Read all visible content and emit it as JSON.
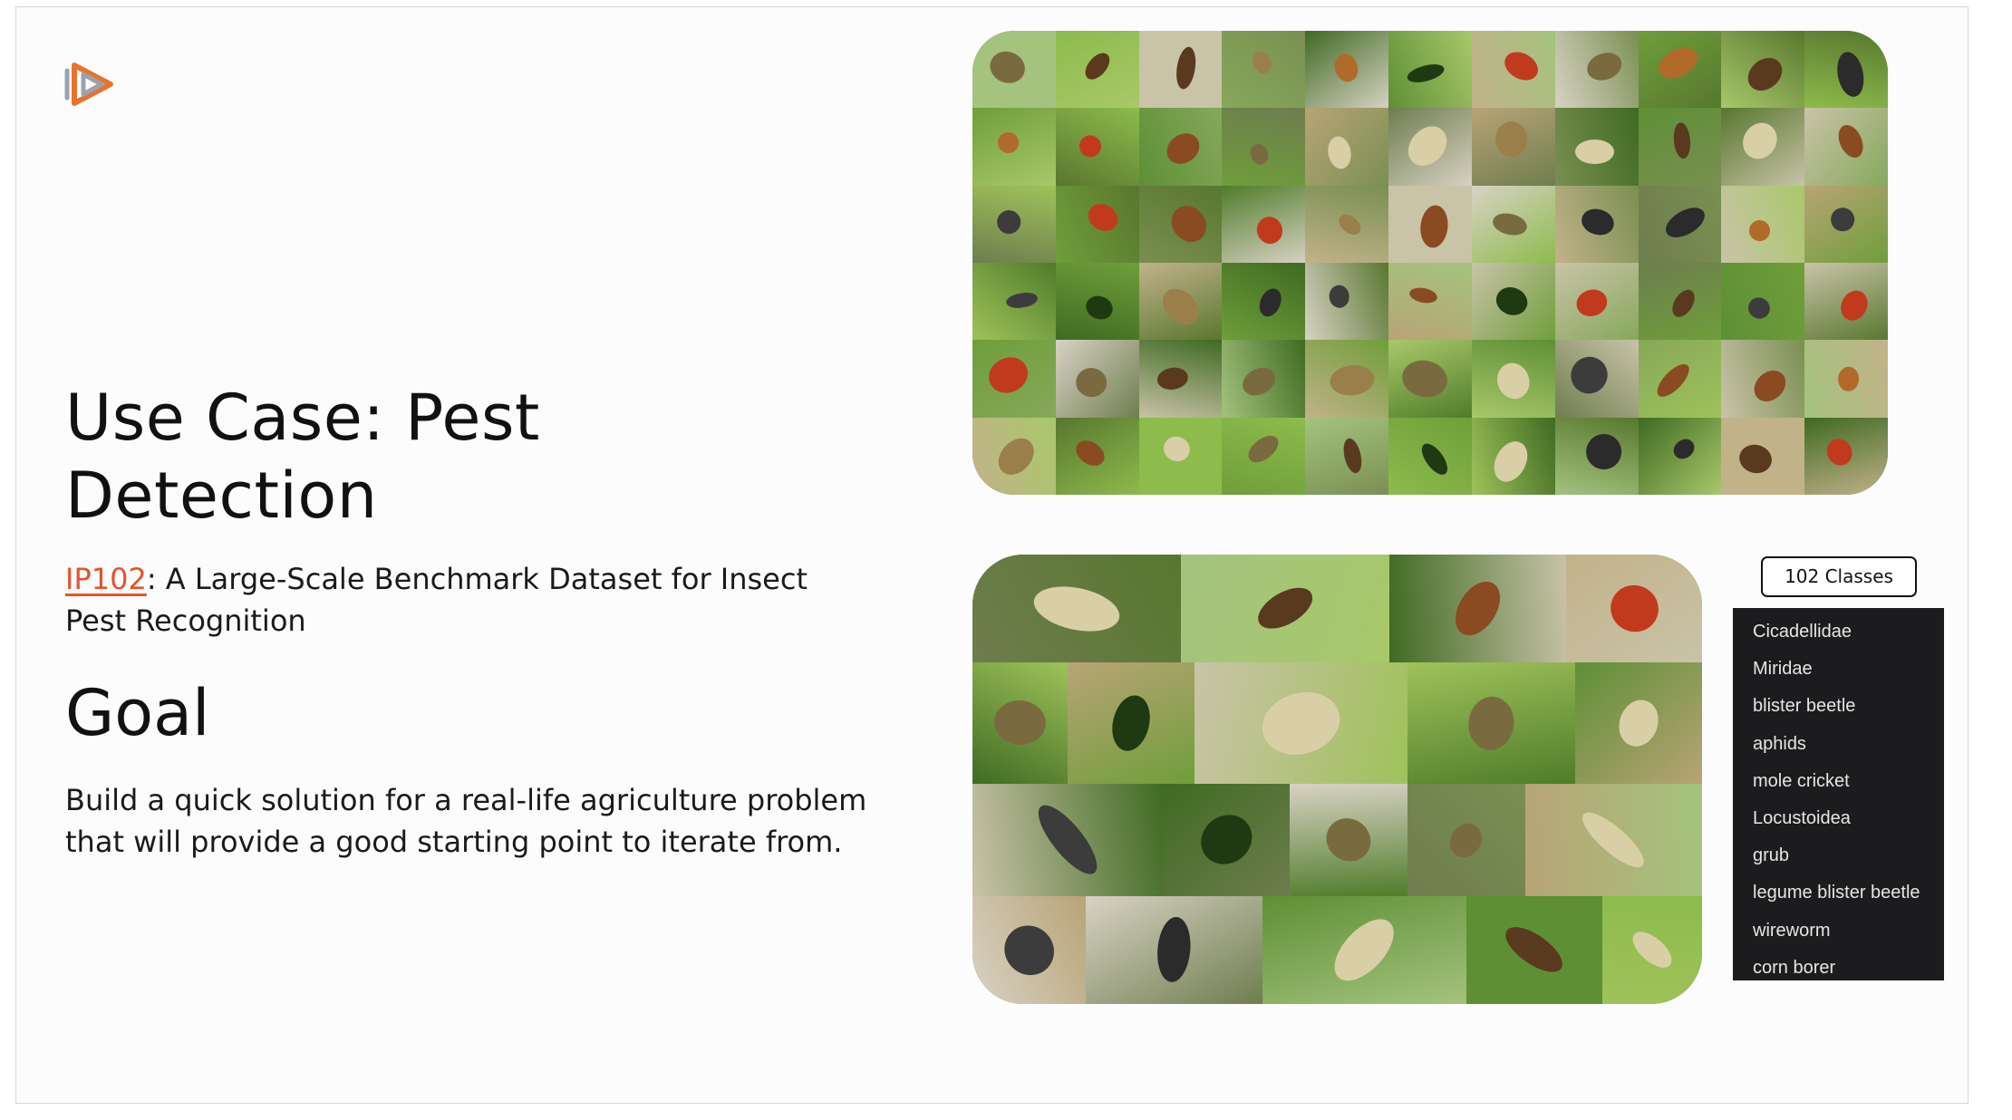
{
  "slide": {
    "title": "Use Case: Pest Detection",
    "subtitle_link": "IP102",
    "subtitle_rest": ": A Large-Scale Benchmark Dataset for Insect Pest Recognition",
    "goal_heading": "Goal",
    "goal_body": "Build a quick solution for a real-life agriculture problem that will provide a good starting point to iterate from."
  },
  "classes": {
    "button_label": "102 Classes",
    "items": [
      "Cicadellidae",
      "Miridae",
      "blister beetle",
      "aphids",
      "mole cricket",
      "Locustoidea",
      "grub",
      "legume blister beetle",
      "wireworm",
      "corn borer"
    ]
  },
  "colors": {
    "accent": "#e2542a",
    "title": "#111111",
    "list_bg": "#1c1c1e"
  },
  "icons": {
    "logo": "play-logo-icon"
  }
}
